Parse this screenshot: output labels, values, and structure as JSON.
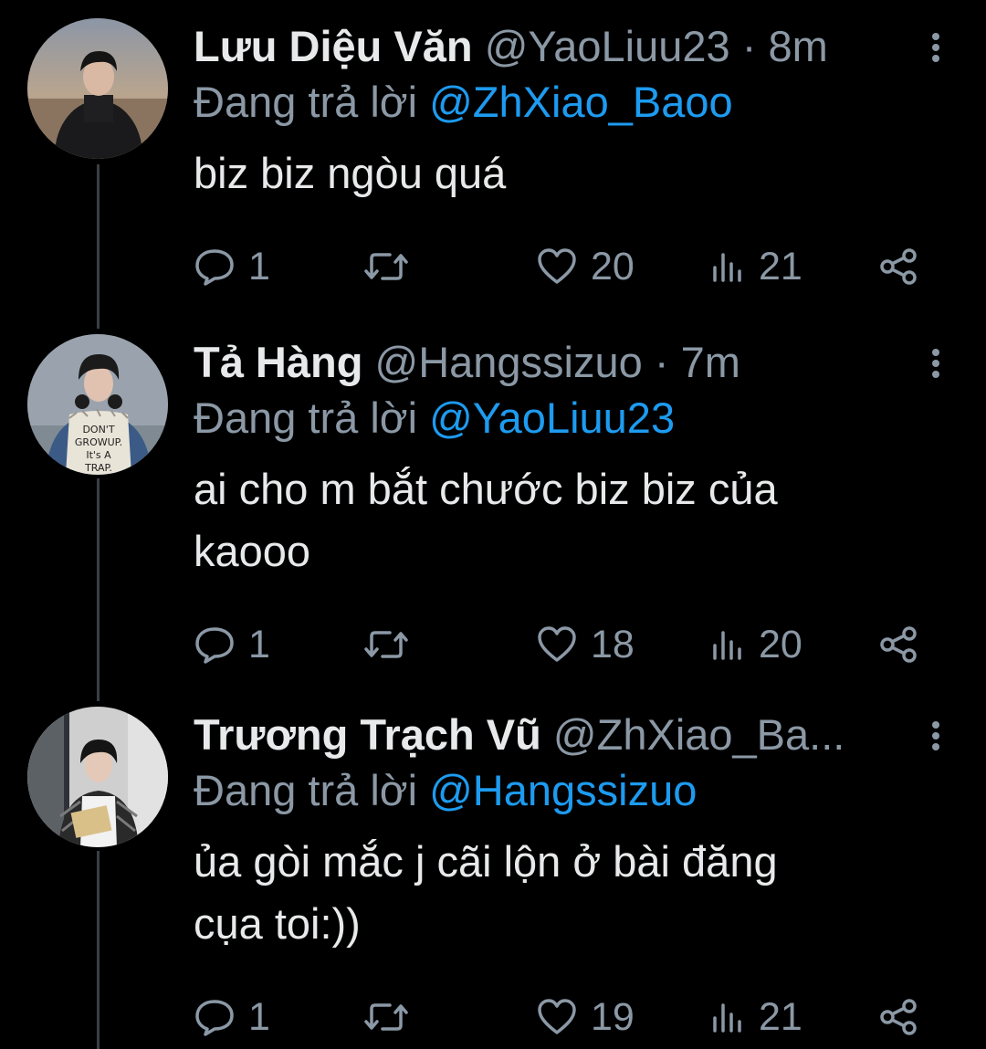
{
  "colors": {
    "background": "#000000",
    "primary_text": "#e7e9ea",
    "secondary_text": "#8b98a5",
    "link": "#1d9bf0",
    "thread_line": "#3a3f44"
  },
  "tweets": [
    {
      "display_name": "Lưu Diệu Văn",
      "handle": "@YaoLiuu23",
      "separator": "·",
      "time": "8m",
      "reply_prefix": "Đang trả lời",
      "reply_to": "@ZhXiao_Baoo",
      "text": "biz biz ngòu quá",
      "replies": "1",
      "retweets": "",
      "likes": "20",
      "views": "21",
      "icons": [
        "reply-icon",
        "retweet-icon",
        "like-icon",
        "views-icon",
        "share-icon",
        "more-icon"
      ]
    },
    {
      "display_name": "Tả Hàng",
      "handle": "@Hangssizuo",
      "separator": "·",
      "time": "7m",
      "reply_prefix": "Đang trả lời",
      "reply_to": "@YaoLiuu23",
      "text": "ai cho m bắt chước biz biz của\nkaooo",
      "replies": "1",
      "retweets": "",
      "likes": "18",
      "views": "20",
      "avatar_shirt_text": "DON'T GROWUP. It's A TRAP."
    },
    {
      "display_name": "Trương Trạch Vũ",
      "handle": "@ZhXiao_Ba...",
      "separator": "",
      "time": "",
      "reply_prefix": "Đang trả lời",
      "reply_to": "@Hangssizuo",
      "text": "ủa gòi mắc j cãi lộn ở bài đăng\ncụa toi:))",
      "replies": "1",
      "retweets": "",
      "likes": "19",
      "views": "21"
    }
  ]
}
